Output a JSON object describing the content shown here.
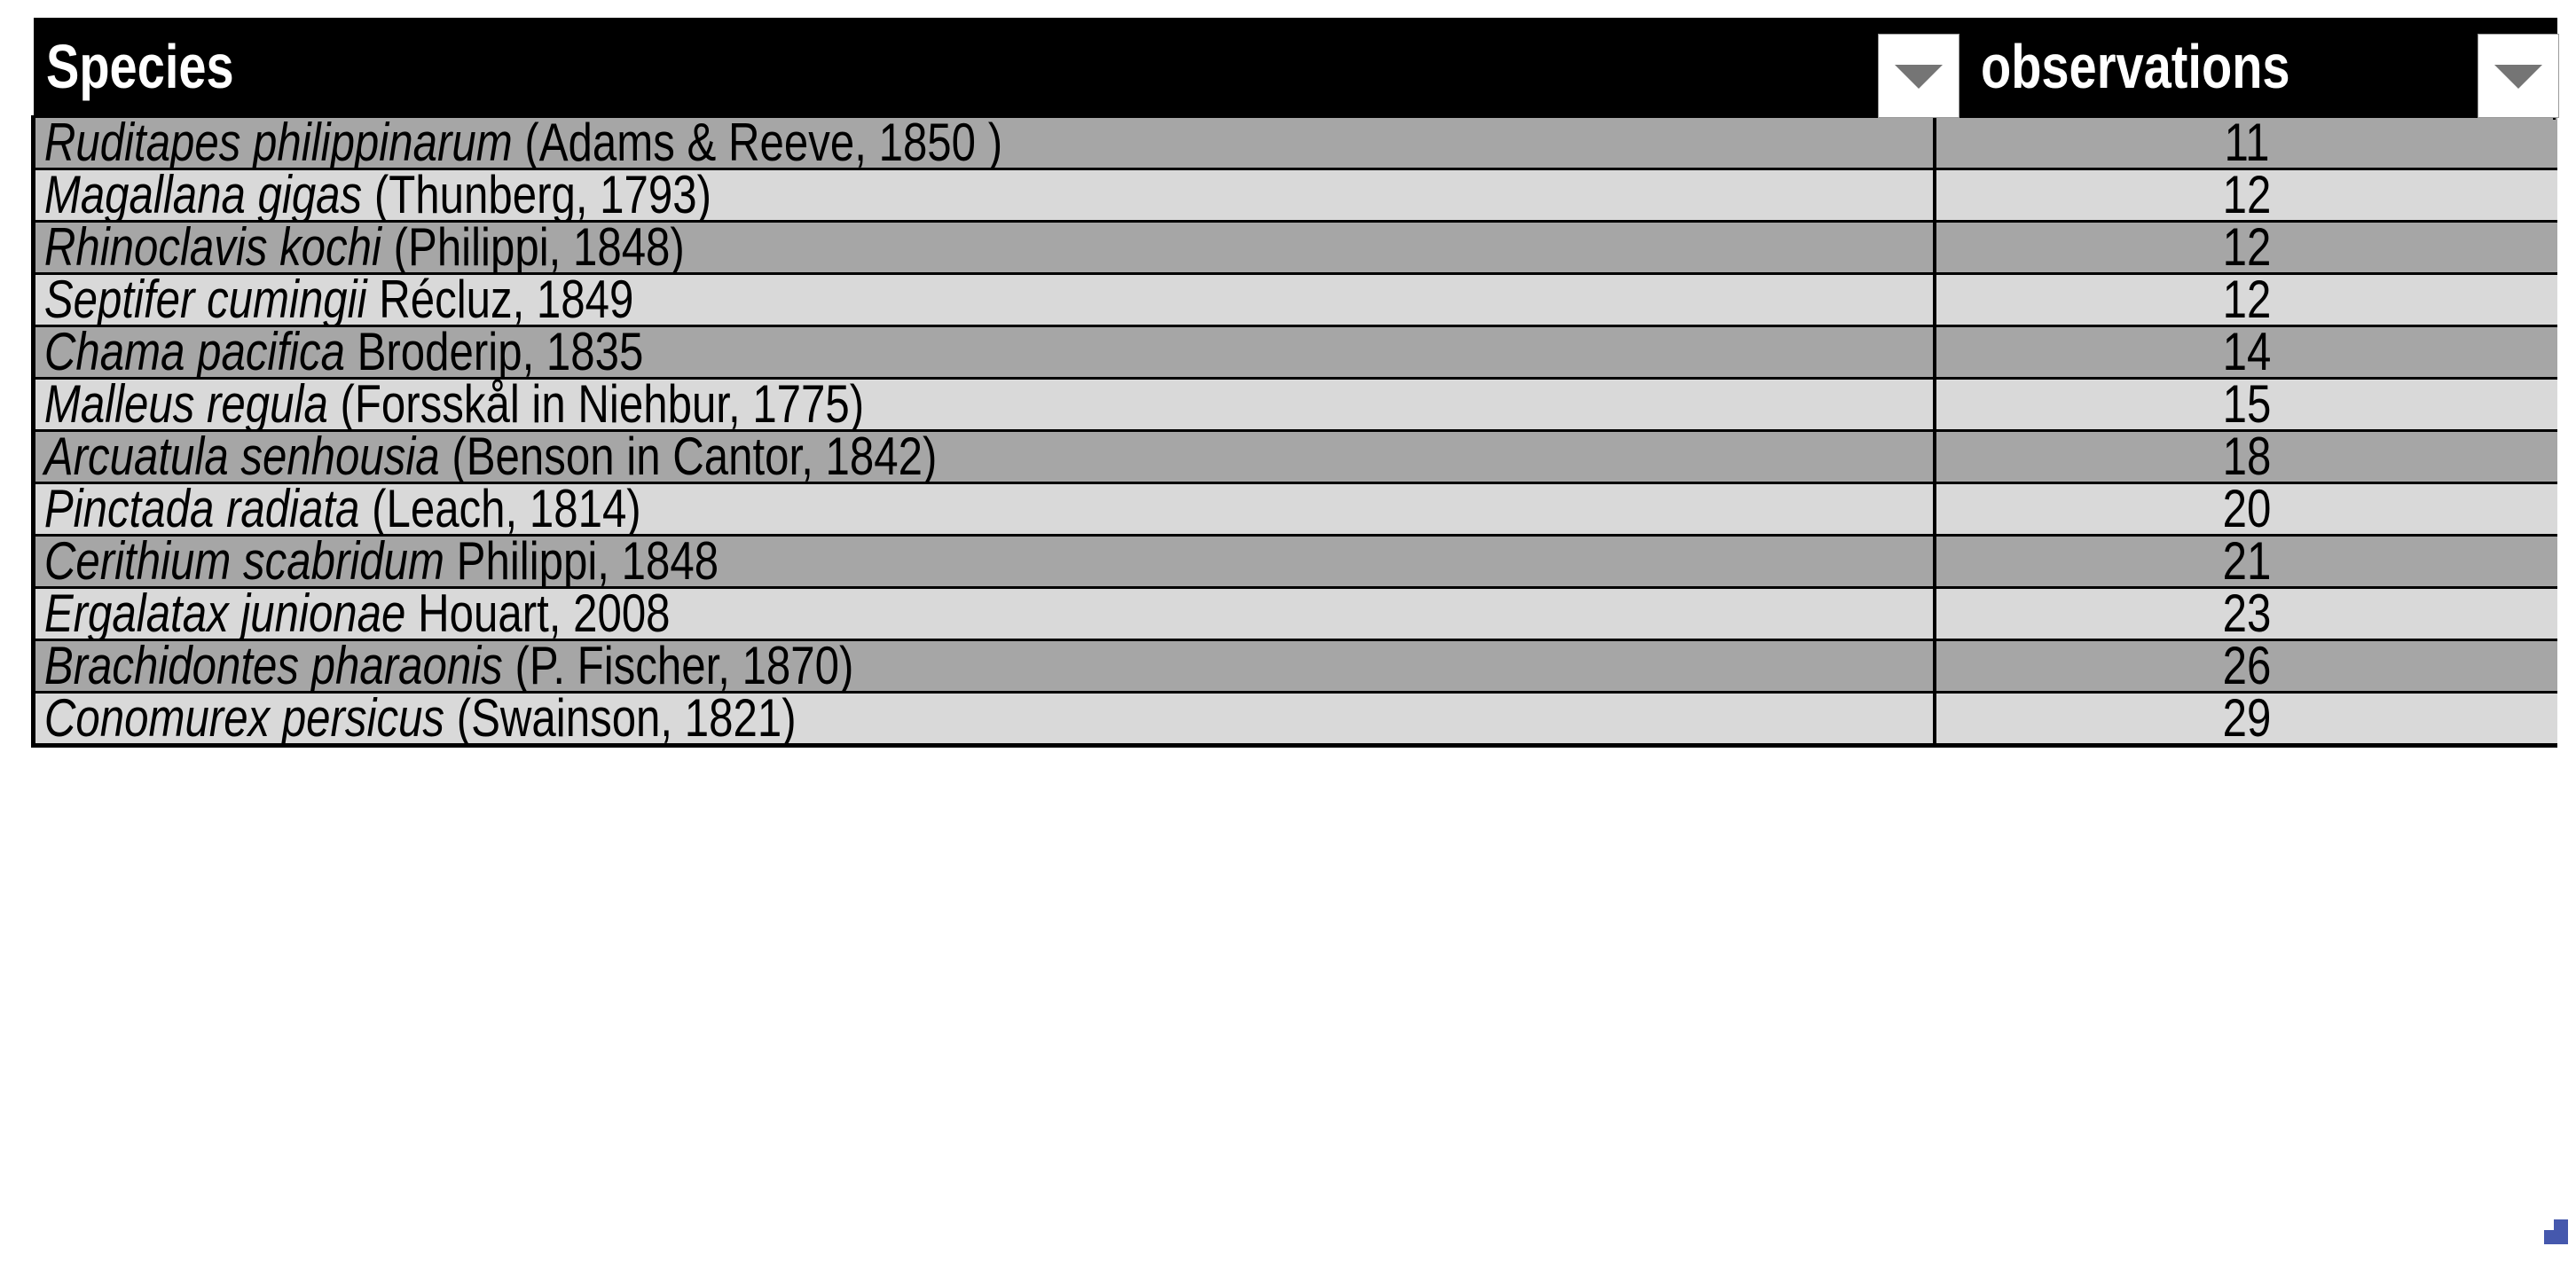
{
  "table": {
    "columns": [
      {
        "key": "species",
        "label": "Species",
        "align": "left",
        "has_filter": true
      },
      {
        "key": "observations",
        "label": "observations",
        "align": "center",
        "has_filter": true
      }
    ],
    "filter_icon": "chevron-down-icon",
    "rows": [
      {
        "scientific_name": "Ruditapes philippinarum",
        "authority": "(Adams & Reeve, 1850 )",
        "observations": "11",
        "shade": "dark"
      },
      {
        "scientific_name": "Magallana gigas",
        "authority": "(Thunberg, 1793)",
        "observations": "12",
        "shade": "light"
      },
      {
        "scientific_name": "Rhinoclavis kochi",
        "authority": "(Philippi, 1848)",
        "observations": "12",
        "shade": "dark"
      },
      {
        "scientific_name": "Septifer cumingii",
        "authority": "Récluz, 1849",
        "observations": "12",
        "shade": "light"
      },
      {
        "scientific_name": "Chama pacifica",
        "authority": "Broderip, 1835",
        "observations": "14",
        "shade": "dark"
      },
      {
        "scientific_name": "Malleus regula",
        "authority": "(Forsskål in Niehbur, 1775)",
        "observations": "15",
        "shade": "light"
      },
      {
        "scientific_name": "Arcuatula senhousia",
        "authority": "(Benson in Cantor, 1842)",
        "observations": "18",
        "shade": "dark"
      },
      {
        "scientific_name": "Pinctada radiata",
        "authority": "(Leach, 1814)",
        "observations": "20",
        "shade": "light"
      },
      {
        "scientific_name": "Cerithium scabridum",
        "authority": "Philippi, 1848",
        "observations": "21",
        "shade": "dark"
      },
      {
        "scientific_name": "Ergalatax junionae",
        "authority": "Houart, 2008",
        "observations": "23",
        "shade": "light"
      },
      {
        "scientific_name": "Brachidontes pharaonis",
        "authority": "(P. Fischer, 1870)",
        "observations": "26",
        "shade": "dark"
      },
      {
        "scientific_name": "Conomurex persicus",
        "authority": "(Swainson, 1821)",
        "observations": "29",
        "shade": "light"
      }
    ]
  },
  "colors": {
    "header_background": "#000000",
    "header_text": "#ffffff",
    "row_dark": "#a6a6a6",
    "row_light": "#d9d9d9",
    "grid_line": "#000000",
    "fill_handle": "#4558ad",
    "caret": "#757575"
  },
  "selection": {
    "fill_handle_name": "fill-handle"
  }
}
